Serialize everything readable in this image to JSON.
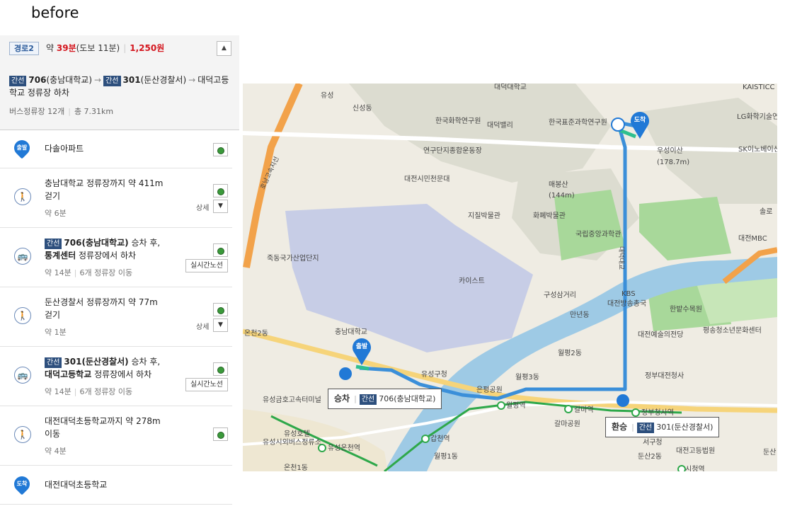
{
  "heading": "before",
  "summary": {
    "badge": "경로2",
    "prefix": "약",
    "time": "39분",
    "walk": "(도보 11분)",
    "fare": "1,250원",
    "collapse_icon": "▲",
    "route": {
      "tag1": "간선",
      "bus1": "706",
      "bus1_name": "(충남대학교)",
      "tag2": "간선",
      "bus2": "301",
      "bus2_name": "(둔산경찰서)",
      "dest": "대덕고등학교 정류장 하차"
    },
    "stops": "버스정류장 12개",
    "distance": "총 7.31km"
  },
  "steps": [
    {
      "type": "start",
      "pin": "출발",
      "text": "다솔아파트"
    },
    {
      "type": "walk",
      "line1": "충남대학교 정류장까지 약 411m",
      "line2": "걷기",
      "sub": "약 6분",
      "detail": "상세",
      "chev": "▼"
    },
    {
      "type": "bus",
      "tag": "간선",
      "bus": "706(충남대학교)",
      "after": " 승차 후,",
      "stop": "통계센터",
      "tail": " 정류장에서 하차",
      "sub1": "약 14분",
      "sub2": "6개 정류장 이동",
      "btn": "실시간노선"
    },
    {
      "type": "walk",
      "line1": "둔산경찰서 정류장까지 약 77m",
      "line2": "걷기",
      "sub": "약 1분",
      "detail": "상세",
      "chev": "▼"
    },
    {
      "type": "bus",
      "tag": "간선",
      "bus": "301(둔산경찰서)",
      "after": " 승차 후,",
      "stop": "대덕고등학교",
      "tail": " 정류장에서 하차",
      "sub1": "약 14분",
      "sub2": "6개 정류장 이동",
      "btn": "실시간노선"
    },
    {
      "type": "walk",
      "line1": "대전대덕초등학교까지 약 278m",
      "line2": "이동",
      "sub": "약 4분"
    },
    {
      "type": "end",
      "pin": "도착",
      "text": "대전대덕초등학교"
    }
  ],
  "map": {
    "labels": [
      "대덕대학교",
      "KAISTICC",
      "유성",
      "신성동",
      "한국화학연구원",
      "대덕밸리",
      "한국표준과학연구원",
      "LG화학기술연구원",
      "연구단지종합운동장",
      "SK이노베이션글로벌테크",
      "대전시민천문대",
      "우성이산",
      "(178.7m)",
      "매봉산",
      "(144m)",
      "지질박물관",
      "화폐박물관",
      "솔로",
      "국립중앙과학관",
      "대전MBC",
      "죽동국가산업단지",
      "카이스트",
      "KBS",
      "대전방송총국",
      "한밭수목원",
      "구성삼거리",
      "만년동",
      "대전예술의전당",
      "평송청소년문화센터",
      "충남대학교",
      "온천2동",
      "유성구청",
      "월평2동",
      "월평3동",
      "정부대전청사",
      "유성금호고속터미널",
      "월평역",
      "갈마역",
      "정부청사역",
      "유성호텔",
      "유성시외버스정류소",
      "유성온천역",
      "갑천역",
      "월평1동",
      "서구청",
      "대전고등법원",
      "온천1동",
      "둔산2동",
      "시청역",
      "갈마공원",
      "은평공원",
      "둔산",
      "대덕대교",
      "호남고속지선"
    ],
    "board_callout": {
      "label": "승차",
      "tag": "간선",
      "route": "706(충남대학교)"
    },
    "transfer_callout": {
      "label": "환승",
      "tag": "간선",
      "route": "301(둔산경찰서)"
    },
    "start_pin": "출발",
    "end_pin": "도착"
  },
  "colors": {
    "route": "#3b8fd9",
    "red": "#d4161e",
    "tag": "#2d4f7d",
    "pin": "#2179d6",
    "subway": "#2ea84a"
  }
}
